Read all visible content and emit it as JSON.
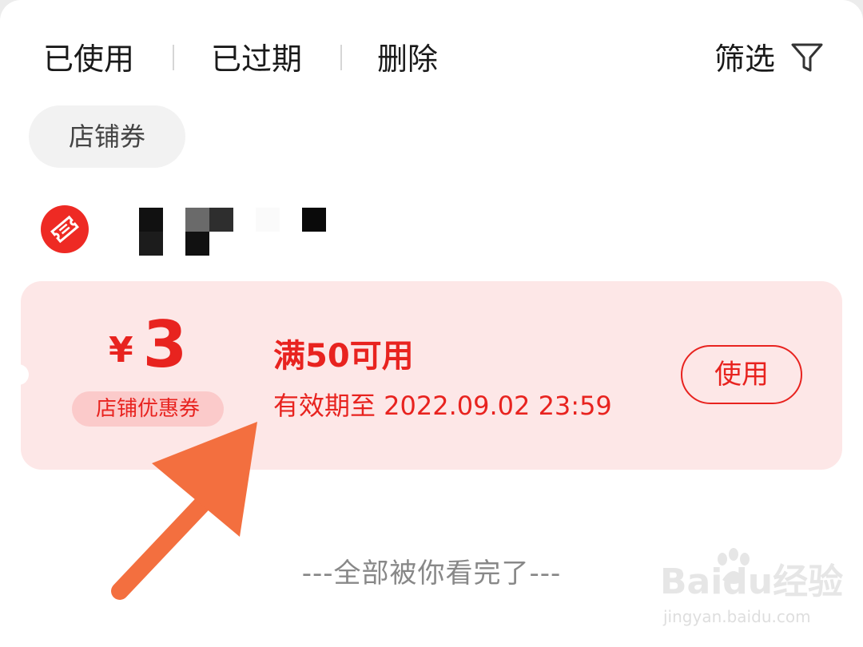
{
  "tabs": {
    "used": "已使用",
    "expired": "已过期",
    "delete": "删除",
    "filter": "筛选"
  },
  "chip": {
    "label": "店铺券"
  },
  "store": {
    "icon": "coupon-ticket-icon",
    "name_obscured": true
  },
  "coupon": {
    "currency": "¥",
    "amount": "3",
    "type": "店铺优惠券",
    "condition": "满50可用",
    "validity": "有效期至 2022.09.02 23:59",
    "use_label": "使用"
  },
  "footer": {
    "end_text": "---全部被你看完了---"
  },
  "watermark": {
    "brand": "Baidu经验",
    "site": "jingyan.baidu.com"
  },
  "colors": {
    "accent": "#e8231f",
    "coupon_bg": "#fde7e7",
    "arrow": "#f36f3f"
  }
}
